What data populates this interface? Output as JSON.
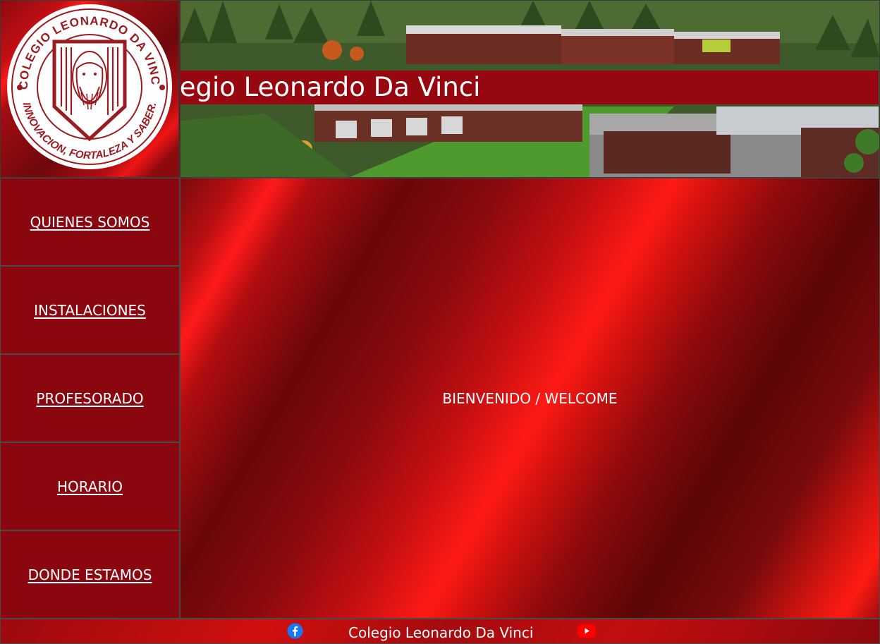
{
  "header": {
    "logo": {
      "top_arc_text": "COLEGIO LEONARDO DA VINCI",
      "bottom_arc_text": "INNOVACION, FORTALEZA Y SABER."
    },
    "banner_title": "Colegio Leonardo Da Vinci"
  },
  "nav": {
    "items": [
      {
        "label": "QUIENES SOMOS"
      },
      {
        "label": "INSTALACIONES"
      },
      {
        "label": "PROFESORADO"
      },
      {
        "label": "HORARIO"
      },
      {
        "label": "DONDE ESTAMOS"
      }
    ]
  },
  "main": {
    "welcome_text": "BIENVENIDO / WELCOME"
  },
  "footer": {
    "title": "Colegio Leonardo Da Vinci",
    "icons": [
      "facebook-icon",
      "youtube-icon"
    ]
  },
  "colors": {
    "brand_red": "#8a0710",
    "banner_strip": "#970710",
    "facebook_blue": "#1877f2",
    "youtube_red": "#ff0000"
  }
}
